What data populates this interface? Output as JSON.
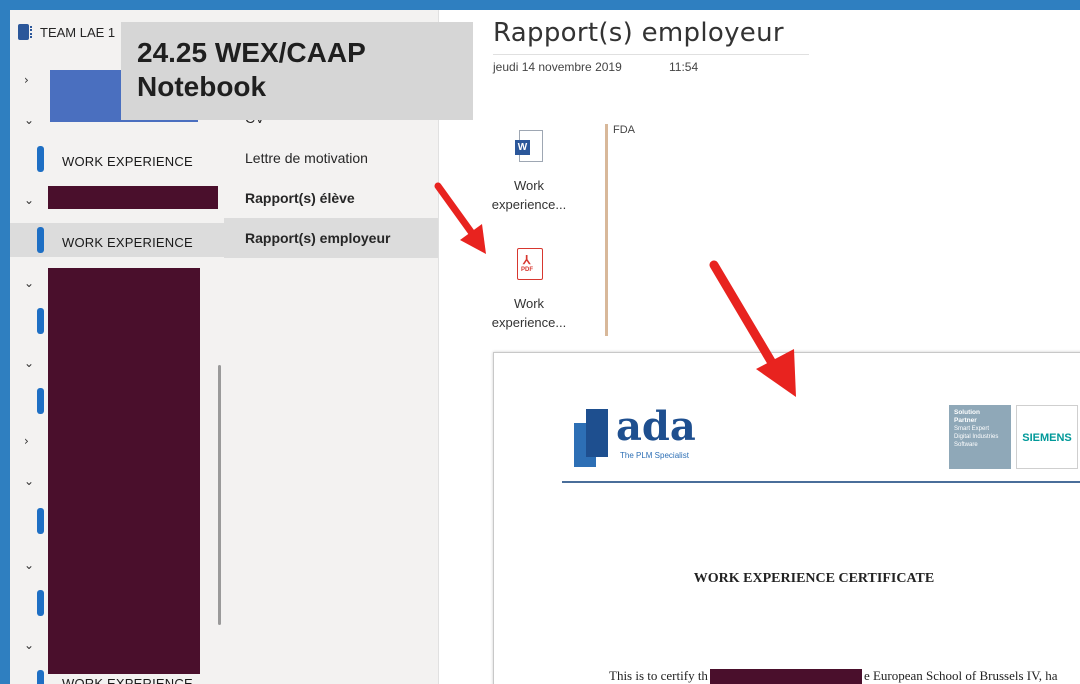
{
  "notebook": {
    "name": "TEAM LAE 1"
  },
  "overlay": {
    "line1": "24.25 WEX/CAAP",
    "line2": "Notebook"
  },
  "sections": [
    {
      "label": "WORK EXPERIENCE",
      "active": false
    },
    {
      "label": "WORK EXPERIENCE",
      "active": true
    },
    {
      "label": "WORK EXPERIENCE",
      "active": false
    }
  ],
  "pages": [
    {
      "label": "CV",
      "bold": false
    },
    {
      "label": "Lettre de motivation",
      "bold": false
    },
    {
      "label": "Rapport(s) élève",
      "bold": true
    },
    {
      "label": "Rapport(s) employeur",
      "bold": true,
      "active": true
    }
  ],
  "page": {
    "title": "Rapport(s) employeur",
    "date": "jeudi 14 novembre 2019",
    "time": "11:54"
  },
  "attachments": [
    {
      "type": "word",
      "icon": "word-file-icon",
      "label_line1": "Work",
      "label_line2": "experience..."
    },
    {
      "type": "pdf",
      "icon": "pdf-file-icon",
      "label_line1": "Work",
      "label_line2": "experience..."
    }
  ],
  "note": {
    "text": "FDA"
  },
  "document": {
    "logo_word": "ada",
    "logo_tagline": "The PLM Specialist",
    "partner_lines": [
      "Solution",
      "Partner",
      "Smart Expert",
      "Digital Industries",
      "Software"
    ],
    "siemens": "SIEMENS",
    "title": "WORK EXPERIENCE CERTIFICATE",
    "body_start": "This is to certify th",
    "body_end": "e European School of Brussels IV,  ha"
  },
  "colors": {
    "accent": "#1e6fc4",
    "redaction": "#4a0f2c",
    "arrow": "#e8231f"
  }
}
